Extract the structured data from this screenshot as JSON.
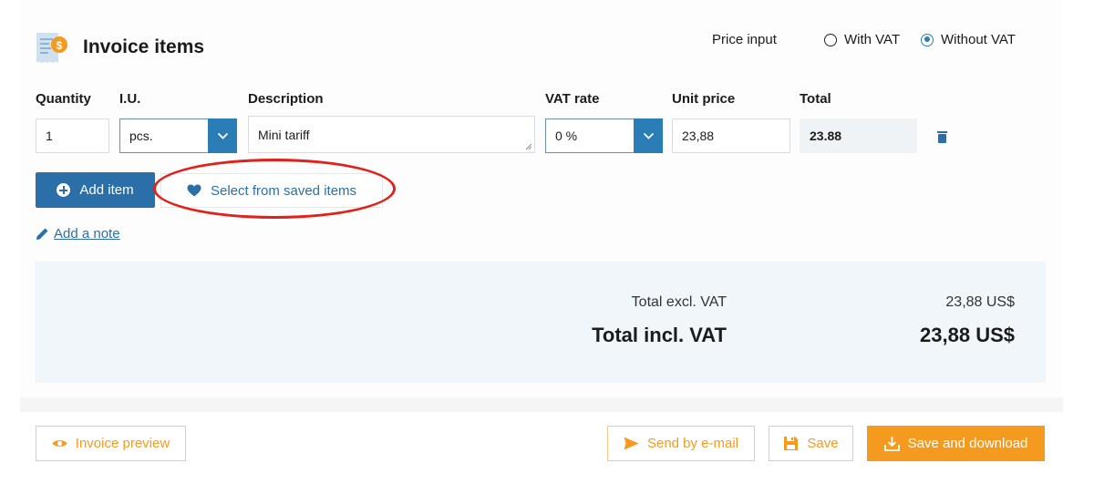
{
  "header": {
    "title": "Invoice items",
    "icon": "invoice-icon",
    "price_input_label": "Price input",
    "price_input_options": [
      "With VAT",
      "Without VAT"
    ],
    "price_input_selected": "Without VAT"
  },
  "columns": {
    "quantity": "Quantity",
    "unit": "I.U.",
    "description": "Description",
    "vat_rate": "VAT rate",
    "unit_price": "Unit price",
    "total": "Total"
  },
  "item": {
    "quantity": "1",
    "unit": "pcs.",
    "description": "Mini tariff",
    "vat_rate": "0 %",
    "unit_price": "23,88",
    "total": "23.88"
  },
  "actions": {
    "add_item": "Add item",
    "select_saved": "Select from saved items",
    "add_note": "Add a note"
  },
  "totals": {
    "excl_label": "Total excl. VAT",
    "excl_value": "23,88 US$",
    "incl_label": "Total incl. VAT",
    "incl_value": "23,88 US$"
  },
  "footer": {
    "preview": "Invoice preview",
    "send_email": "Send by e-mail",
    "save": "Save",
    "save_download": "Save and download"
  },
  "colors": {
    "primary": "#2a6fa8",
    "accent": "#f39a1f",
    "highlight": "#e0221b",
    "totals_bg": "#f0f6fa"
  }
}
